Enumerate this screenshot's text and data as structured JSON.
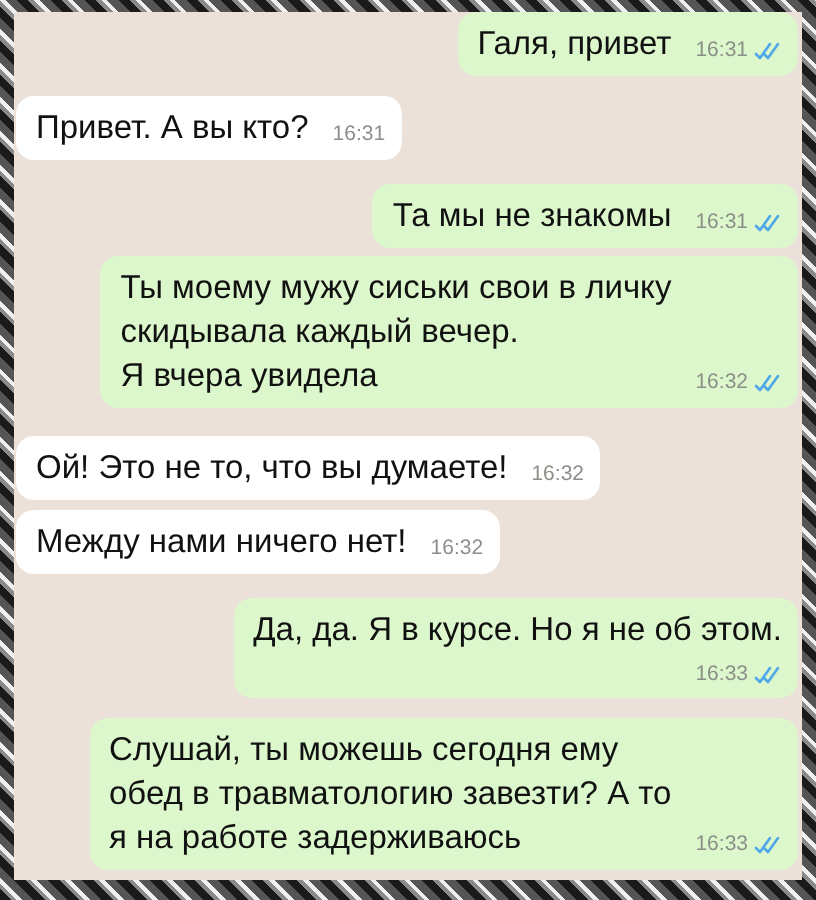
{
  "messages": [
    {
      "outgoing": true,
      "kind": "inline",
      "lines": [
        "Галя, привет"
      ],
      "time": "16:31",
      "read": true
    },
    {
      "outgoing": false,
      "kind": "inline",
      "lines": [
        "Привет. А вы кто?"
      ],
      "time": "16:31"
    },
    {
      "outgoing": true,
      "kind": "inline",
      "lines": [
        "Та мы не знакомы"
      ],
      "time": "16:31",
      "read": true
    },
    {
      "outgoing": true,
      "kind": "inline",
      "lines": [
        "Ты моему мужу сиськи свои в личку",
        "скидывала каждый вечер.",
        "Я вчера увидела"
      ],
      "time": "16:32",
      "read": true
    },
    {
      "outgoing": false,
      "kind": "inline",
      "lines": [
        "Ой! Это не то, что вы думаете!"
      ],
      "time": "16:32"
    },
    {
      "outgoing": false,
      "kind": "inline",
      "lines": [
        "Между нами ничего нет!"
      ],
      "time": "16:32"
    },
    {
      "outgoing": true,
      "kind": "stacked",
      "lines": [
        "Да, да. Я в курсе. Но я не об этом."
      ],
      "time": "16:33",
      "read": true
    },
    {
      "outgoing": true,
      "kind": "inline",
      "lines": [
        "Слушай, ты можешь сегодня ему",
        "обед в травматологию завезти? А то",
        "я на работе задерживаюсь"
      ],
      "time": "16:33",
      "read": true
    }
  ]
}
